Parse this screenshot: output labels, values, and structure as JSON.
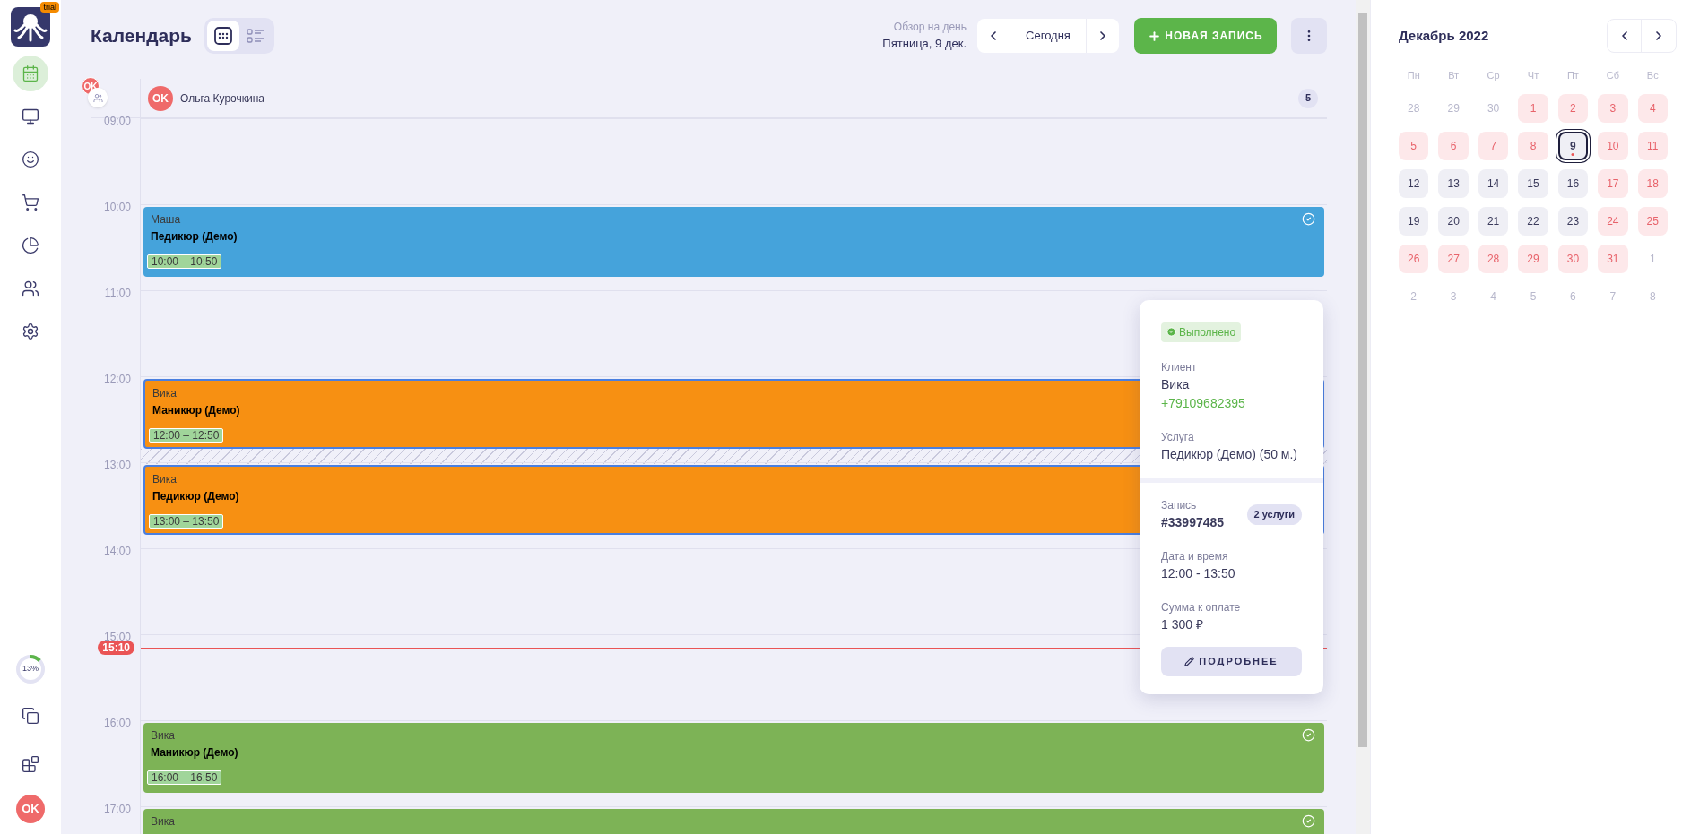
{
  "sidebar": {
    "logo_badge": "trial",
    "nav": [
      {
        "kind": "calendar",
        "selected": true
      },
      {
        "kind": "monitor",
        "selected": false
      },
      {
        "kind": "smile",
        "selected": false
      },
      {
        "kind": "cart",
        "selected": false
      },
      {
        "kind": "chart",
        "selected": false
      },
      {
        "kind": "users",
        "selected": false
      },
      {
        "kind": "settings",
        "selected": false
      }
    ],
    "progress": {
      "label": "13%",
      "level": 0.13
    },
    "bottom_nav": [
      {
        "kind": "copy"
      },
      {
        "kind": "blocks"
      }
    ],
    "avatar": "OK"
  },
  "header": {
    "title": "Календарь",
    "views": [
      {
        "kind": "grid",
        "selected": true
      },
      {
        "kind": "list",
        "selected": false
      }
    ],
    "overview_label": "Обзор на день",
    "date": "Пятница, 9 дек.",
    "today_button": "Сегодня",
    "new_button": "НОВАЯ ЗАПИСЬ"
  },
  "staff_row": {
    "group_avatar": "OK",
    "avatar": "OK",
    "name": "Ольга Курочкина",
    "count": "5"
  },
  "hours": [
    {
      "label": "09:00",
      "gap": false
    },
    {
      "label": "10:00",
      "gap": false,
      "event": {
        "client": "Маша",
        "service": "Педикюр (Демо)",
        "time": "10:00 – 10:50",
        "color": "#45a3db",
        "done": true,
        "selected": false
      }
    },
    {
      "label": "11:00",
      "gap": false
    },
    {
      "label": "12:00",
      "gap": true,
      "event": {
        "client": "Вика",
        "service": "Маникюр (Демо)",
        "time": "12:00 – 12:50",
        "color": "#f79012",
        "done": false,
        "selected": true
      }
    },
    {
      "label": "13:00",
      "gap": false,
      "event": {
        "client": "Вика",
        "service": "Педикюр (Демо)",
        "time": "13:00 – 13:50",
        "color": "#f79012",
        "done": false,
        "selected": true
      }
    },
    {
      "label": "14:00",
      "gap": false
    },
    {
      "label": "15:00",
      "gap": false,
      "now": "15:10"
    },
    {
      "label": "16:00",
      "gap": false,
      "event": {
        "client": "Вика",
        "service": "Маникюр (Демо)",
        "time": "16:00 – 16:50",
        "color": "#7db356",
        "done": true,
        "selected": false
      }
    },
    {
      "label": "17:00",
      "gap": false,
      "event": {
        "client": "Вика",
        "color": "#7db356",
        "done": true,
        "selected": false
      }
    }
  ],
  "popup": {
    "status": {
      "label": "Выполнено",
      "kind": "done"
    },
    "client_label": "Клиент",
    "client_name": "Вика",
    "client_phone": "+79109682395",
    "service_label": "Услуга",
    "service": "Педикюр (Демо) (50 м.)",
    "record_label": "Запись",
    "record_number": "#33997485",
    "services_badge": "2 услуги",
    "datetime_label": "Дата и время",
    "datetime": "12:00 - 13:50",
    "sum_label": "Сумма к оплате",
    "sum": "1 300 ₽",
    "details_button": "ПОДРОБНЕЕ"
  },
  "month": {
    "title": "Декабрь 2022",
    "weekdays": [
      "Пн",
      "Вт",
      "Ср",
      "Чт",
      "Пт",
      "Сб",
      "Вс"
    ],
    "weeks": [
      [
        {
          "label": "28",
          "kind": "other",
          "selected": false
        },
        {
          "label": "29",
          "kind": "other",
          "selected": false
        },
        {
          "label": "30",
          "kind": "other",
          "selected": false
        },
        {
          "label": "1",
          "kind": "booked",
          "selected": false
        },
        {
          "label": "2",
          "kind": "booked",
          "selected": false
        },
        {
          "label": "3",
          "kind": "booked",
          "selected": false
        },
        {
          "label": "4",
          "kind": "booked",
          "selected": false
        }
      ],
      [
        {
          "label": "5",
          "kind": "booked",
          "selected": false
        },
        {
          "label": "6",
          "kind": "booked",
          "selected": false
        },
        {
          "label": "7",
          "kind": "booked",
          "selected": false
        },
        {
          "label": "8",
          "kind": "booked",
          "selected": false
        },
        {
          "label": "9",
          "kind": "open",
          "selected": true
        },
        {
          "label": "10",
          "kind": "booked",
          "selected": false
        },
        {
          "label": "11",
          "kind": "booked",
          "selected": false
        }
      ],
      [
        {
          "label": "12",
          "kind": "open",
          "selected": false
        },
        {
          "label": "13",
          "kind": "open",
          "selected": false
        },
        {
          "label": "14",
          "kind": "open",
          "selected": false
        },
        {
          "label": "15",
          "kind": "open",
          "selected": false
        },
        {
          "label": "16",
          "kind": "open",
          "selected": false
        },
        {
          "label": "17",
          "kind": "booked",
          "selected": false
        },
        {
          "label": "18",
          "kind": "booked",
          "selected": false
        }
      ],
      [
        {
          "label": "19",
          "kind": "open",
          "selected": false
        },
        {
          "label": "20",
          "kind": "open",
          "selected": false
        },
        {
          "label": "21",
          "kind": "open",
          "selected": false
        },
        {
          "label": "22",
          "kind": "open",
          "selected": false
        },
        {
          "label": "23",
          "kind": "open",
          "selected": false
        },
        {
          "label": "24",
          "kind": "booked",
          "selected": false
        },
        {
          "label": "25",
          "kind": "booked",
          "selected": false
        }
      ],
      [
        {
          "label": "26",
          "kind": "booked",
          "selected": false
        },
        {
          "label": "27",
          "kind": "booked",
          "selected": false
        },
        {
          "label": "28",
          "kind": "booked",
          "selected": false
        },
        {
          "label": "29",
          "kind": "booked",
          "selected": false
        },
        {
          "label": "30",
          "kind": "booked",
          "selected": false
        },
        {
          "label": "31",
          "kind": "booked",
          "selected": false
        },
        {
          "label": "1",
          "kind": "other",
          "selected": false
        }
      ],
      [
        {
          "label": "2",
          "kind": "other",
          "selected": false
        },
        {
          "label": "3",
          "kind": "other",
          "selected": false
        },
        {
          "label": "4",
          "kind": "other",
          "selected": false
        },
        {
          "label": "5",
          "kind": "other",
          "selected": false
        },
        {
          "label": "6",
          "kind": "other",
          "selected": false
        },
        {
          "label": "7",
          "kind": "other",
          "selected": false
        },
        {
          "label": "8",
          "kind": "other",
          "selected": false
        }
      ]
    ]
  }
}
